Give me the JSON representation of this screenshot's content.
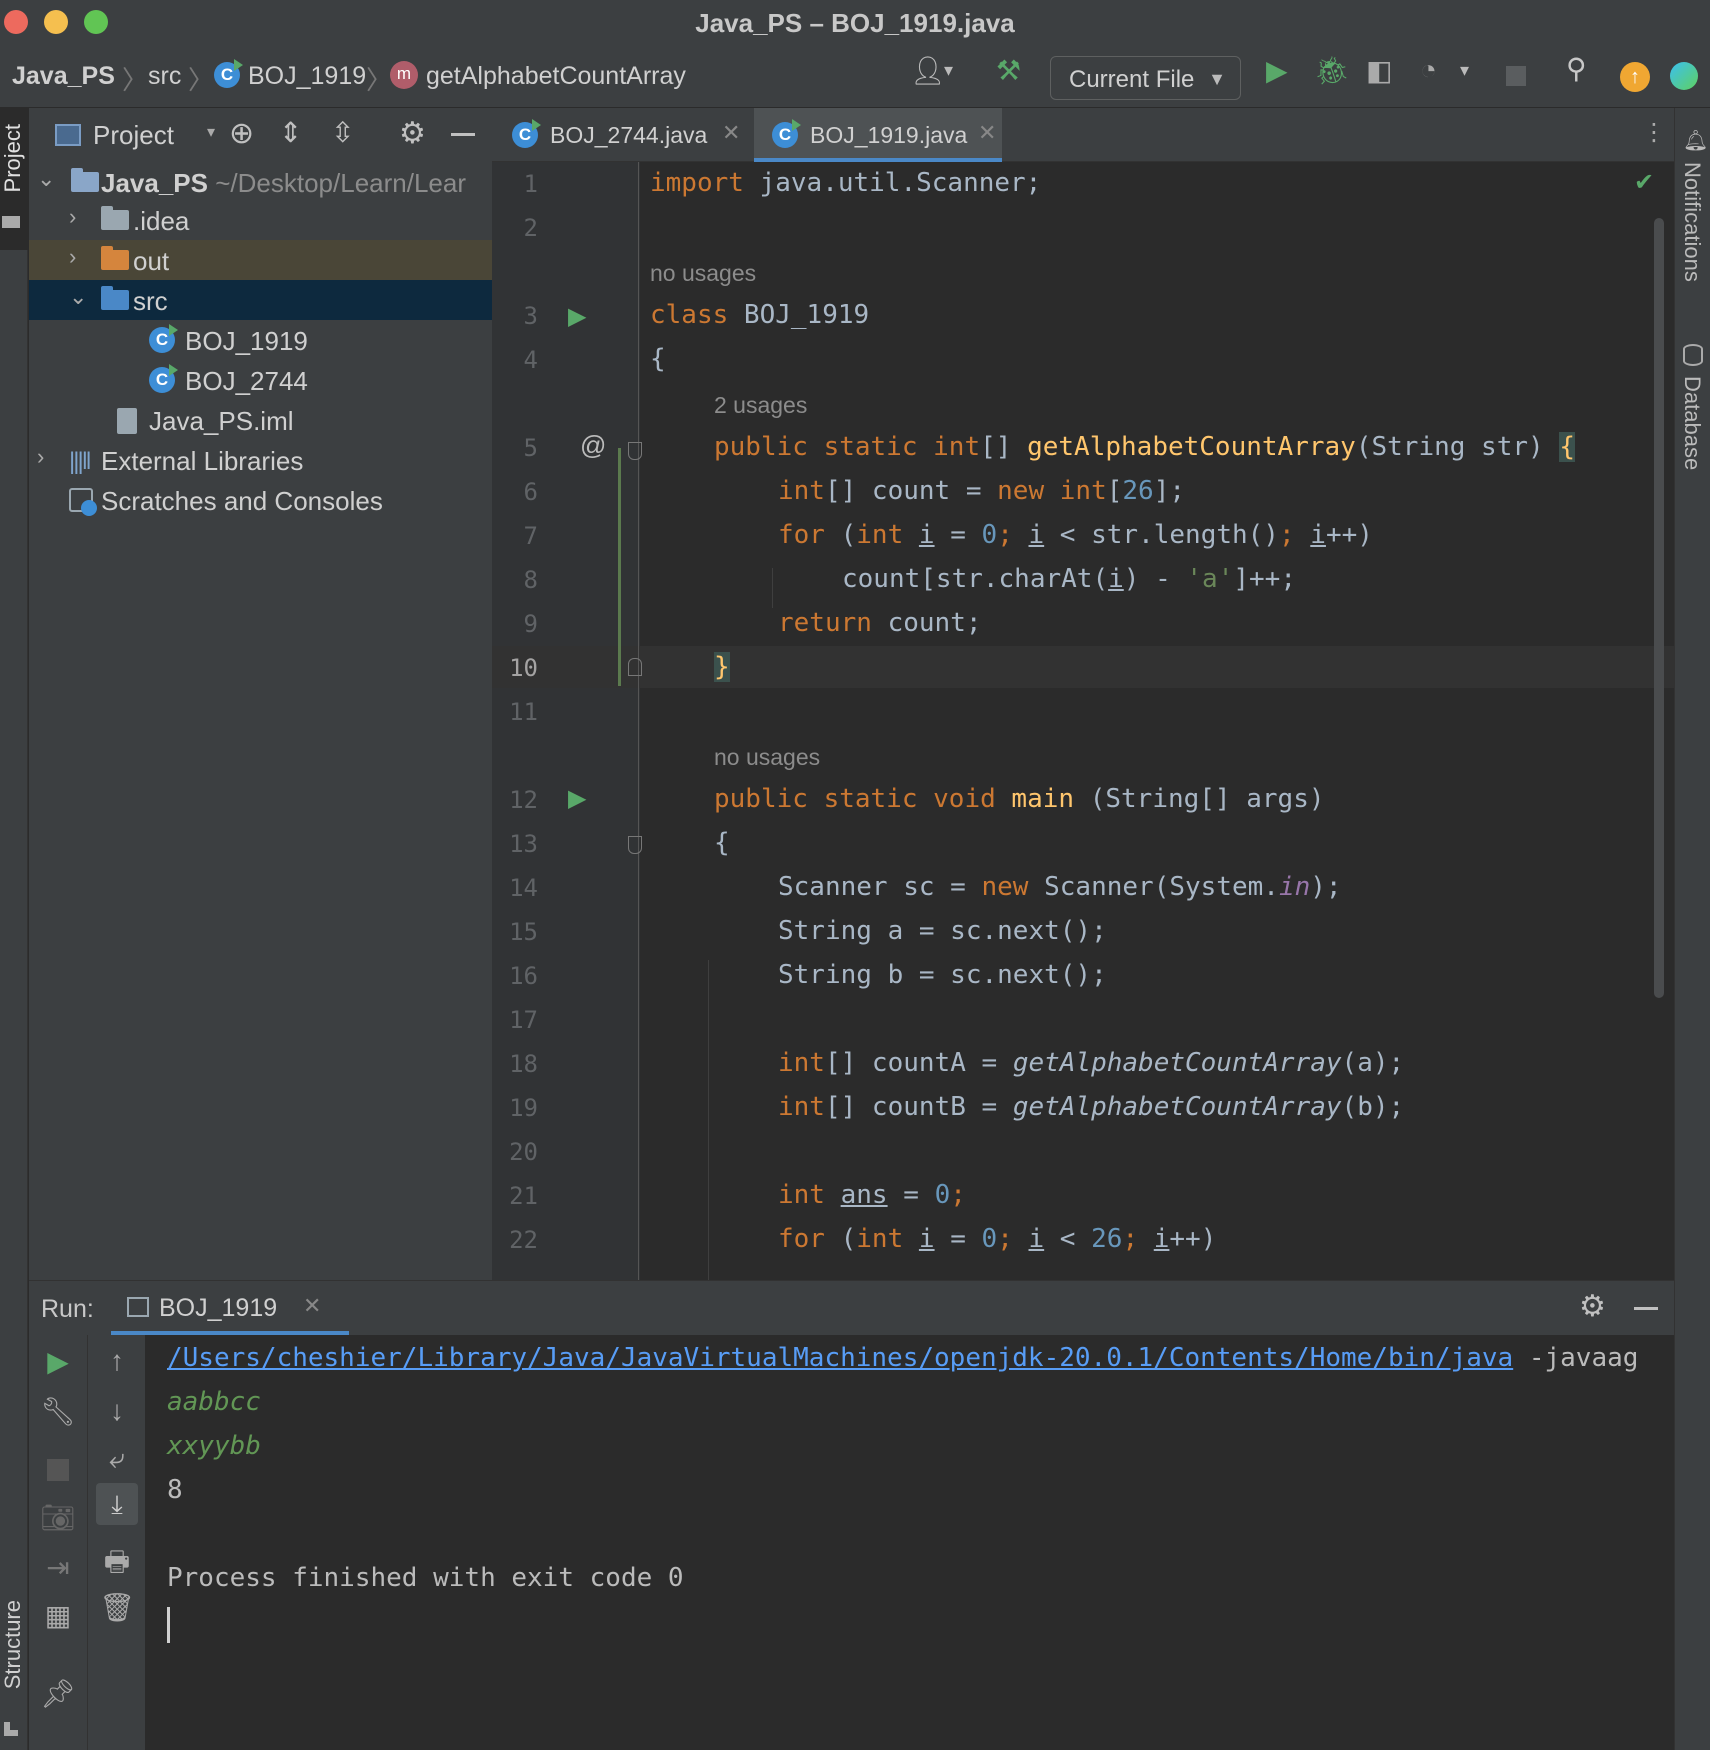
{
  "window": {
    "title": "Java_PS – BOJ_1919.java"
  },
  "breadcrumb": {
    "project": "Java_PS",
    "folder": "src",
    "file": "BOJ_1919",
    "method": "getAlphabetCountArray"
  },
  "toolbar": {
    "run_config": "Current File"
  },
  "left_strip": {
    "project_label": "Project",
    "structure_label": "Structure"
  },
  "right_strip": {
    "notifications_label": "Notifications",
    "database_label": "Database"
  },
  "project_panel": {
    "title": "Project",
    "tree": [
      {
        "label": "Java_PS",
        "path": "~/Desktop/Learn/Lear"
      },
      {
        "label": ".idea"
      },
      {
        "label": "out"
      },
      {
        "label": "src"
      },
      {
        "label": "BOJ_1919"
      },
      {
        "label": "BOJ_2744"
      },
      {
        "label": "Java_PS.iml"
      },
      {
        "label": "External Libraries"
      },
      {
        "label": "Scratches and Consoles"
      }
    ]
  },
  "editor": {
    "tabs": [
      {
        "label": "BOJ_2744.java",
        "active": false
      },
      {
        "label": "BOJ_1919.java",
        "active": true
      }
    ],
    "hints": {
      "no_usages_1": "no usages",
      "two_usages": "2 usages",
      "no_usages_2": "no usages"
    },
    "line_numbers": [
      "1",
      "2",
      "3",
      "4",
      "5",
      "6",
      "7",
      "8",
      "9",
      "10",
      "11",
      "12",
      "13",
      "14",
      "15",
      "16",
      "17",
      "18",
      "19",
      "20",
      "21",
      "22"
    ],
    "code": {
      "l1_import": "import",
      "l1_rest": " java.util.Scanner;",
      "l3_class": "class",
      "l3_name": " BOJ_1919",
      "l4": "{",
      "l5_mods": "public static ",
      "l5_type": "int",
      "l5_brackets": "[] ",
      "l5_fn": "getAlphabetCountArray",
      "l5_params": "(String str) ",
      "l5_brace": "{",
      "l6_type": "int",
      "l6_mid": "[] count = ",
      "l6_new": "new ",
      "l6_int": "int",
      "l6_open": "[",
      "l6_num": "26",
      "l6_close": "];",
      "l7_for": "for ",
      "l7_p": "(",
      "l7_int": "int ",
      "l7_i": "i",
      "l7_eq": " = ",
      "l7_zero": "0",
      "l7_semi": "; ",
      "l7_i2": "i",
      "l7_cond": " < str.length()",
      "l7_semi2": "; ",
      "l7_i3": "i",
      "l7_inc": "++)",
      "l8_a": "count[str.charAt(",
      "l8_i": "i",
      "l8_b": ") - ",
      "l8_str": "'a'",
      "l8_c": "]++;",
      "l9_ret": "return ",
      "l9_rest": "count;",
      "l10": "}",
      "l12_mods": "public static void ",
      "l12_fn": "main",
      "l12_rest": " (String[] args)",
      "l13": "{",
      "l14_a": "Scanner sc = ",
      "l14_new": "new ",
      "l14_b": "Scanner(System.",
      "l14_in": "in",
      "l14_c": ");",
      "l15": "String a = sc.next();",
      "l16": "String b = sc.next();",
      "l18_int": "int",
      "l18_a": "[] countA = ",
      "l18_fn": "getAlphabetCountArray",
      "l18_b": "(a);",
      "l19_int": "int",
      "l19_a": "[] countB = ",
      "l19_fn": "getAlphabetCountArray",
      "l19_b": "(b);",
      "l21_int": "int ",
      "l21_ans": "ans",
      "l21_eq": " = ",
      "l21_zero": "0",
      "l21_semi": ";",
      "l22_for": "for ",
      "l22_p": "(",
      "l22_int": "int ",
      "l22_i": "i",
      "l22_eq": " = ",
      "l22_zero": "0",
      "l22_semi": "; ",
      "l22_i2": "i",
      "l22_lt": " < ",
      "l22_num": "26",
      "l22_semi2": "; ",
      "l22_i3": "i",
      "l22_inc": "++)"
    }
  },
  "run": {
    "label": "Run:",
    "tab": "BOJ_1919",
    "output": {
      "command_path": "/Users/cheshier/Library/Java/JavaVirtualMachines/openjdk-20.0.1/Contents/Home/bin/java",
      "command_args": " -javaag",
      "input1": "aabbcc",
      "input2": "xxyybb",
      "result": "8",
      "exit": "Process finished with exit code 0"
    }
  },
  "colors": {
    "keyword": "#cc7832",
    "number": "#6897bb",
    "string": "#6a8759",
    "function": "#ffc66d",
    "run_green": "#59a869",
    "selection": "#0d293e"
  }
}
